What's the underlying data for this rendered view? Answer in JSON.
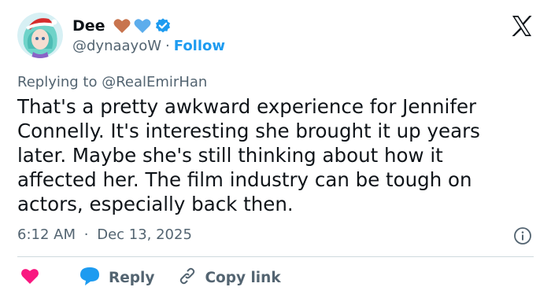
{
  "author": {
    "display_name": "Dee",
    "handle": "@dynaayoW",
    "separator": "·",
    "follow_label": "Follow",
    "emojis": [
      "brown-heart-icon",
      "blue-heart-icon"
    ],
    "verified_icon": "verified-badge-icon"
  },
  "tweet": {
    "replying_prefix": "Replying to",
    "replying_to": "@RealEmirHan",
    "text": "That's a pretty awkward experience for Jennifer\nConnelly. It's interesting she brought it up years\nlater. Maybe she's still thinking about how it\naffected her. The film industry can be tough on\nactors, especially back then.",
    "time": "6:12 AM",
    "date": "Dec 13, 2025",
    "meta_separator": "·"
  },
  "actions": {
    "reply_label": "Reply",
    "copy_link_label": "Copy link"
  },
  "colors": {
    "accent": "#1d9bf0",
    "heart": "#f91880",
    "secondary_text": "#536471",
    "primary_text": "#0f1419",
    "divider": "#cfd9de"
  }
}
